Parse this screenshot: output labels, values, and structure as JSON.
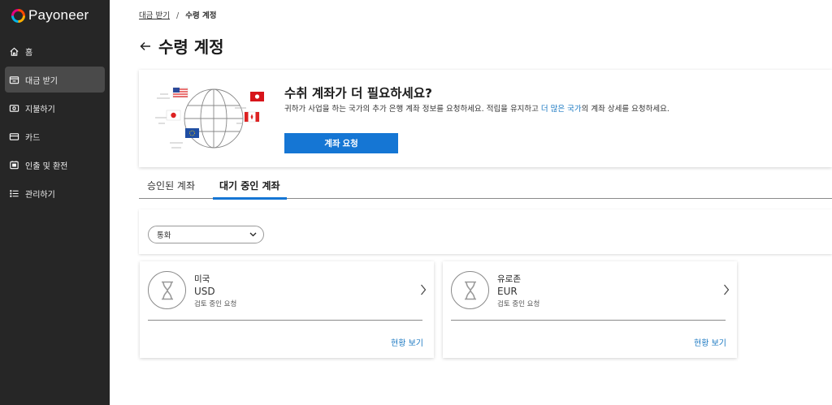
{
  "brand": {
    "name": "Payoneer"
  },
  "sidebar": {
    "items": [
      {
        "label": "홈",
        "icon": "home-icon",
        "active": false
      },
      {
        "label": "대금 받기",
        "icon": "receive-icon",
        "active": true
      },
      {
        "label": "지불하기",
        "icon": "pay-icon",
        "active": false
      },
      {
        "label": "카드",
        "icon": "card-icon",
        "active": false
      },
      {
        "label": "인출 및 환전",
        "icon": "withdraw-icon",
        "active": false
      },
      {
        "label": "관리하기",
        "icon": "manage-list-icon",
        "active": false
      }
    ]
  },
  "breadcrumb": {
    "parent": "대금 받기",
    "separator": "/",
    "current": "수령 계정"
  },
  "page": {
    "title": "수령 계정"
  },
  "promo": {
    "heading": "수취 계좌가 더 필요하세요?",
    "desc_part1": "귀하가 사업을 하는 국가의 추가 은행 계좌 정보를 요청하세요. 적립을 유지하고 ",
    "desc_link": "더 많은 국가",
    "desc_part2": "의 계좌 상세를 요청하세요.",
    "button_label": "계좌 요청"
  },
  "tabs": [
    {
      "label": "승인된 계좌",
      "active": false
    },
    {
      "label": "대기 중인 계좌",
      "active": true
    }
  ],
  "filter": {
    "currency_label": "통화"
  },
  "accounts": [
    {
      "region": "미국",
      "currency": "USD",
      "status": "검토 중인 요청",
      "link": "현황 보기"
    },
    {
      "region": "유로존",
      "currency": "EUR",
      "status": "검토 중인 요청",
      "link": "현황 보기"
    }
  ],
  "colors": {
    "sidebar_bg": "#262626",
    "accent": "#1576d4",
    "link": "#1a78c2"
  }
}
